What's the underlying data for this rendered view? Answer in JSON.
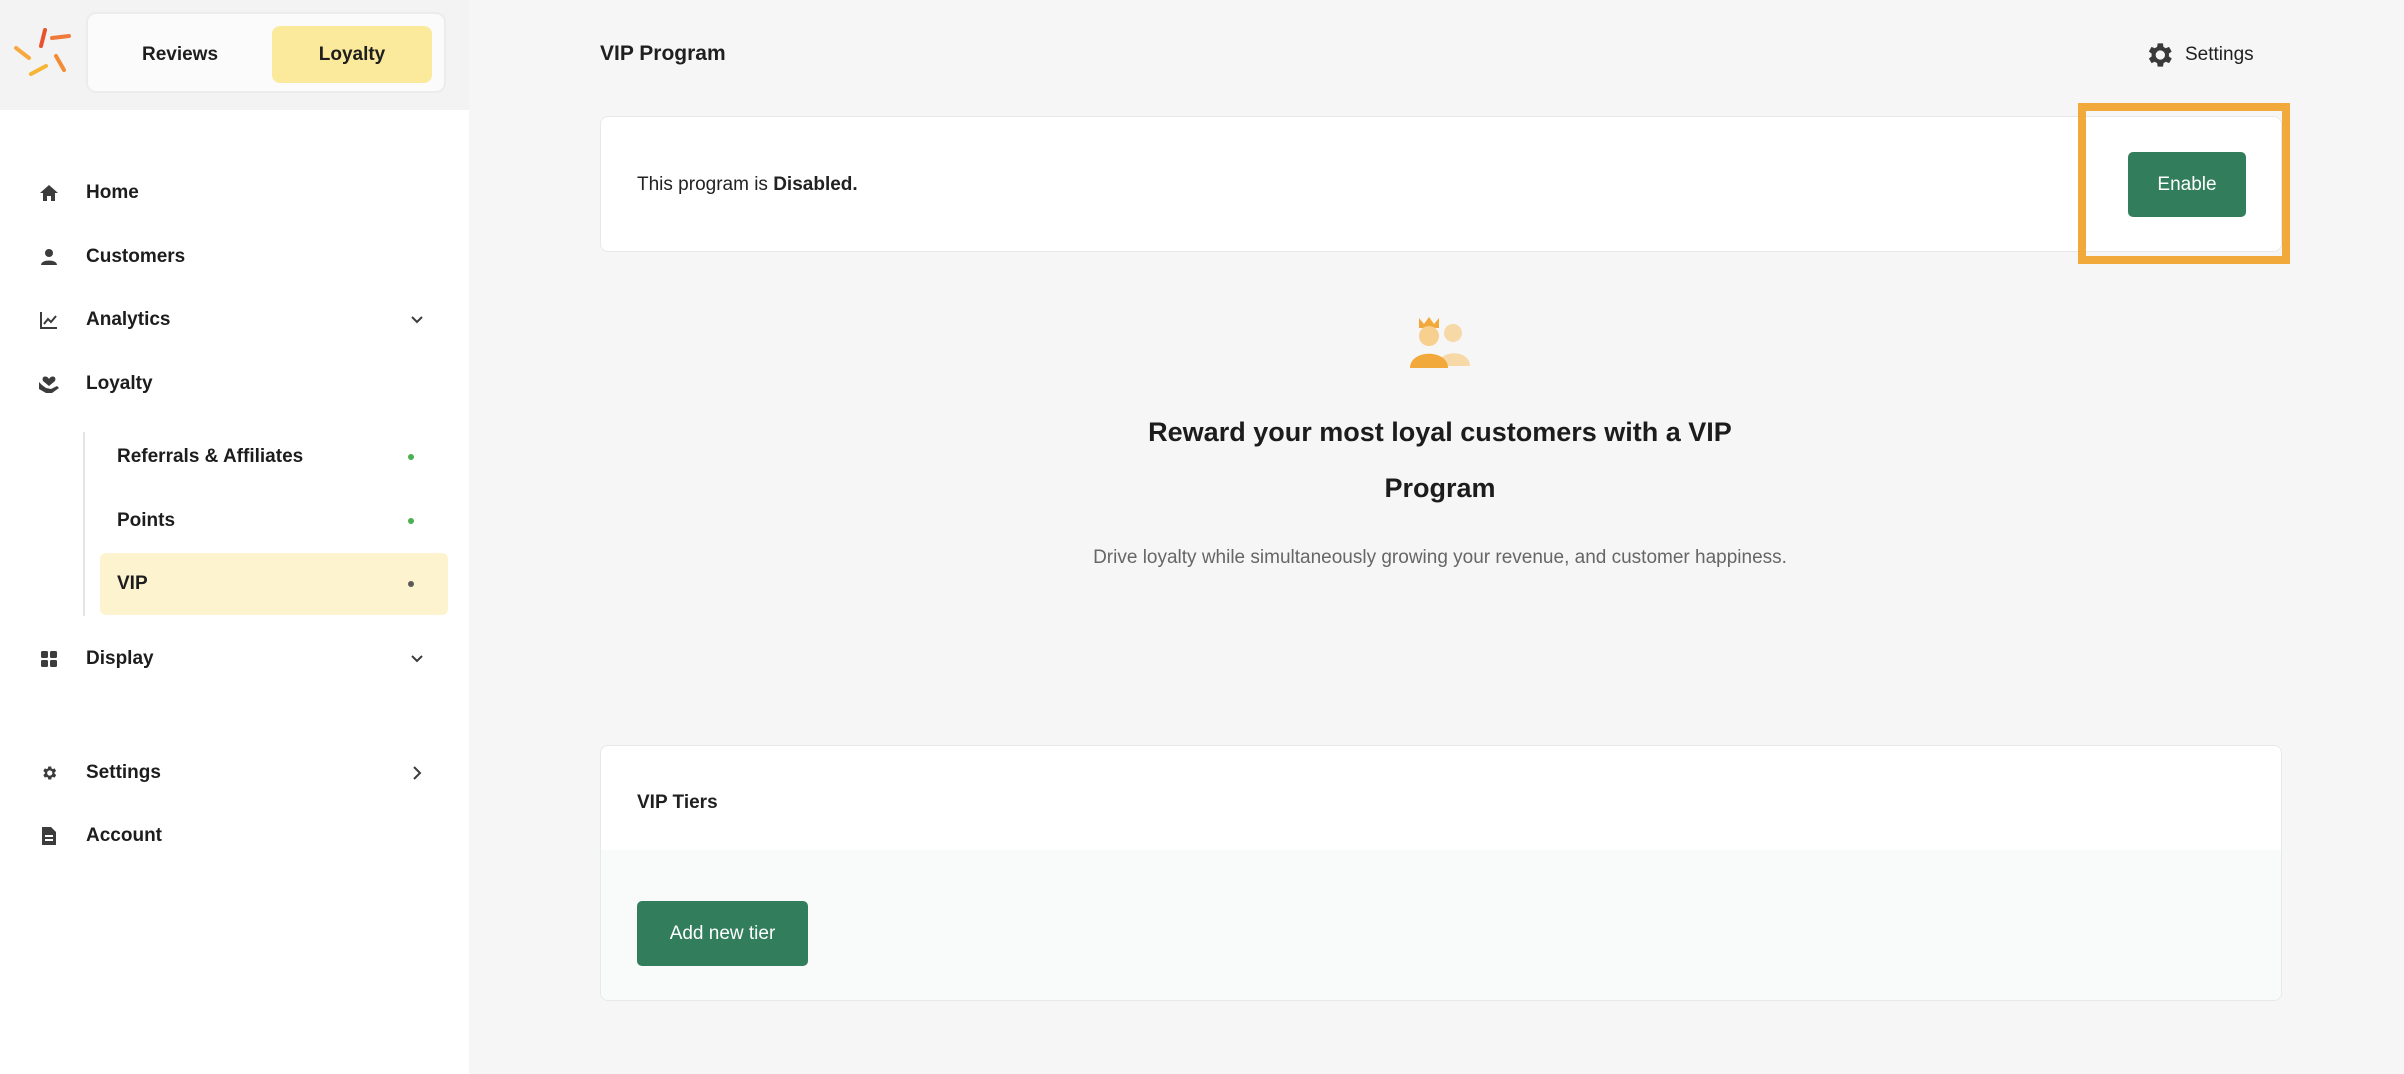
{
  "app_switcher": {
    "tabs": [
      {
        "label": "Reviews"
      },
      {
        "label": "Loyalty",
        "active": true
      }
    ]
  },
  "sidebar": {
    "items": [
      {
        "label": "Home",
        "icon": "home-icon"
      },
      {
        "label": "Customers",
        "icon": "person-icon"
      },
      {
        "label": "Analytics",
        "icon": "chart-line-icon",
        "expandable": true
      },
      {
        "label": "Loyalty",
        "icon": "hand-heart-icon"
      },
      {
        "label": "Display",
        "icon": "grid-icon",
        "expandable": true
      },
      {
        "label": "Settings",
        "icon": "gear-icon",
        "has_submenu": true
      },
      {
        "label": "Account",
        "icon": "document-icon"
      }
    ],
    "loyalty_subitems": [
      {
        "label": "Referrals & Affiliates",
        "status": "enabled"
      },
      {
        "label": "Points",
        "status": "enabled"
      },
      {
        "label": "VIP",
        "status": "disabled",
        "active": true
      }
    ]
  },
  "header": {
    "title": "VIP Program",
    "settings_label": "Settings"
  },
  "status_card": {
    "prefix": "This program is ",
    "status": "Disabled.",
    "enable_label": "Enable"
  },
  "hero": {
    "icon": "vip-customers-icon",
    "title": "Reward your most loyal customers with a VIP Program",
    "description": "Drive loyalty while simultaneously growing your revenue, and customer happiness."
  },
  "tiers": {
    "title": "VIP Tiers",
    "add_label": "Add new tier"
  },
  "colors": {
    "primary_button": "#327d5b",
    "active_tab": "#fcea9c",
    "active_subitem": "#fdf3cf",
    "highlight": "#f2a93b",
    "status_dot_enabled": "#4caf50"
  }
}
